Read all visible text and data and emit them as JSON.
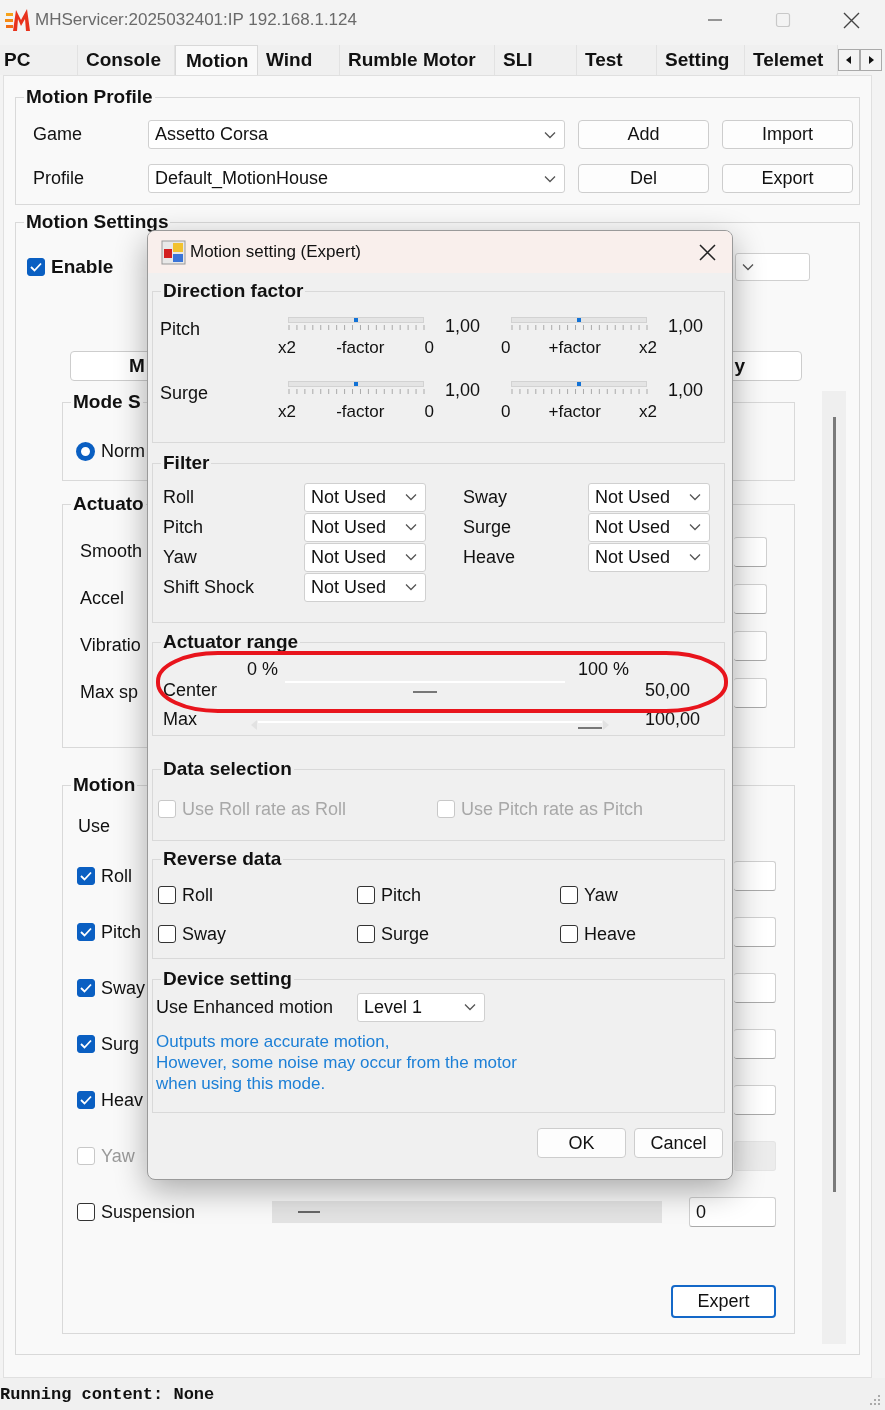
{
  "window": {
    "title": "MHServicer:2025032401:IP 192.168.1.124"
  },
  "tabs": [
    {
      "label": "PC",
      "selected": false
    },
    {
      "label": "Console",
      "selected": false
    },
    {
      "label": "Motion",
      "selected": true
    },
    {
      "label": "Wind",
      "selected": false
    },
    {
      "label": "Rumble Motor",
      "selected": false
    },
    {
      "label": "SLI",
      "selected": false
    },
    {
      "label": "Test",
      "selected": false
    },
    {
      "label": "Setting",
      "selected": false
    },
    {
      "label": "Telemet",
      "selected": false
    }
  ],
  "motion_profile": {
    "title": "Motion Profile",
    "rows": [
      {
        "label": "Game",
        "value": "Assetto Corsa",
        "buttons": [
          "Add",
          "Import"
        ]
      },
      {
        "label": "Profile",
        "value": "Default_MotionHouse",
        "buttons": [
          "Del",
          "Export"
        ]
      }
    ]
  },
  "motion_settings": {
    "title": "Motion Settings",
    "enable": {
      "label": "Enable",
      "checked": true
    },
    "mode_button": {
      "texts": [
        "M",
        "y"
      ]
    },
    "mode_group": {
      "title": "Mode S",
      "option": {
        "label": "Norm",
        "selected": true
      }
    },
    "actuator_group": {
      "title": "Actuato",
      "rows": [
        {
          "label": "Smooth"
        },
        {
          "label": "Accel"
        },
        {
          "label": "Vibratio"
        },
        {
          "label": "Max sp"
        }
      ]
    },
    "motion_group": {
      "title": "Motion",
      "use_label": "Use",
      "rows": [
        {
          "label": "Roll",
          "checked": true,
          "disabled": false
        },
        {
          "label": "Pitch",
          "checked": true,
          "disabled": false
        },
        {
          "label": "Sway",
          "checked": true,
          "disabled": false
        },
        {
          "label": "Surg",
          "checked": true,
          "disabled": false
        },
        {
          "label": "Heav",
          "checked": true,
          "disabled": false
        },
        {
          "label": "Yaw",
          "checked": false,
          "disabled": true
        }
      ],
      "suspension": {
        "label": "Suspension",
        "checked": false,
        "level": 0.07,
        "value": "0"
      },
      "expert_button": "Expert"
    }
  },
  "dialog": {
    "title": "Motion setting (Expert)",
    "direction_factor": {
      "title": "Direction factor",
      "rows": [
        {
          "label": "Pitch",
          "sliders": [
            {
              "level": 0.5,
              "value": "1,00",
              "scale": [
                "x2",
                "-factor",
                "0"
              ]
            },
            {
              "level": 0.5,
              "value": "1,00",
              "scale": [
                "0",
                "+factor",
                "x2"
              ]
            }
          ]
        },
        {
          "label": "Surge",
          "sliders": [
            {
              "level": 0.5,
              "value": "1,00",
              "scale": [
                "x2",
                "-factor",
                "0"
              ]
            },
            {
              "level": 0.5,
              "value": "1,00",
              "scale": [
                "0",
                "+factor",
                "x2"
              ]
            }
          ]
        }
      ]
    },
    "filter": {
      "title": "Filter",
      "left": [
        {
          "label": "Roll",
          "value": "Not Used"
        },
        {
          "label": "Pitch",
          "value": "Not Used"
        },
        {
          "label": "Yaw",
          "value": "Not Used"
        },
        {
          "label": "Shift Shock",
          "value": "Not Used"
        }
      ],
      "right": [
        {
          "label": "Sway",
          "value": "Not Used"
        },
        {
          "label": "Surge",
          "value": "Not Used"
        },
        {
          "label": "Heave",
          "value": "Not Used"
        }
      ]
    },
    "actuator_range": {
      "title": "Actuator range",
      "highlight": {
        "kind": "ellipse"
      },
      "center": {
        "label": "Center",
        "min_label": "0 %",
        "max_label": "100 %",
        "level": 0.5,
        "value": "50,00"
      },
      "max": {
        "label": "Max",
        "level": 1,
        "value": "100,00"
      }
    },
    "data_selection": {
      "title": "Data selection",
      "options": [
        {
          "label": "Use Roll rate as Roll",
          "checked": false,
          "disabled": true
        },
        {
          "label": "Use Pitch rate as Pitch",
          "checked": false,
          "disabled": true
        }
      ]
    },
    "reverse_data": {
      "title": "Reverse data",
      "options": [
        {
          "label": "Roll",
          "checked": false
        },
        {
          "label": "Pitch",
          "checked": false
        },
        {
          "label": "Yaw",
          "checked": false
        },
        {
          "label": "Sway",
          "checked": false
        },
        {
          "label": "Surge",
          "checked": false
        },
        {
          "label": "Heave",
          "checked": false
        }
      ]
    },
    "device_setting": {
      "title": "Device setting",
      "label": "Use Enhanced motion",
      "value": "Level 1",
      "note": [
        "Outputs more accurate motion,",
        "However, some noise may occur from the motor",
        "when using this mode."
      ]
    },
    "buttons": [
      "OK",
      "Cancel"
    ]
  },
  "status_bar": {
    "text": "Running content: None"
  }
}
